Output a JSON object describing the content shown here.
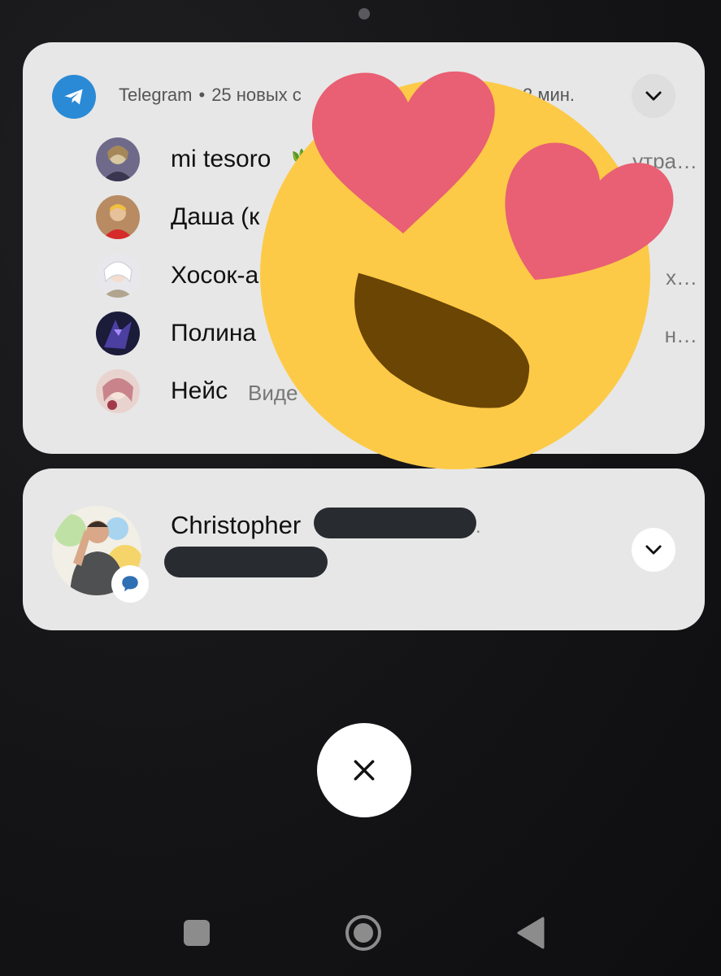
{
  "telegram": {
    "app_name": "Telegram",
    "separator": "•",
    "summary": "25 новых с",
    "time": "2 мин.",
    "messages": [
      {
        "sender": "mi tesoro",
        "preview": "",
        "tail": "утра…"
      },
      {
        "sender": "Даша (к",
        "preview": "",
        "tail": ""
      },
      {
        "sender": "Хосок-а",
        "preview": "",
        "tail": "х…"
      },
      {
        "sender": "Полина",
        "preview": "",
        "tail": "н…"
      },
      {
        "sender": "Нейс",
        "preview": "Виде",
        "tail": ""
      }
    ]
  },
  "contact": {
    "name": "Christopher",
    "trailing": "."
  },
  "colors": {
    "card_bg": "#e7e7e7",
    "telegram_blue": "#2a8ad6",
    "redaction": "#282b30",
    "emoji_face": "#fdca47",
    "emoji_heart": "#e95f73",
    "emoji_mouth": "#6b4504"
  },
  "icons": {
    "app": "telegram-logo-icon",
    "expand": "chevron-down-icon",
    "badge": "message-bubble-icon",
    "close": "close-x-icon",
    "nav": [
      "recent-apps-square-icon",
      "home-circle-icon",
      "back-triangle-icon"
    ]
  }
}
